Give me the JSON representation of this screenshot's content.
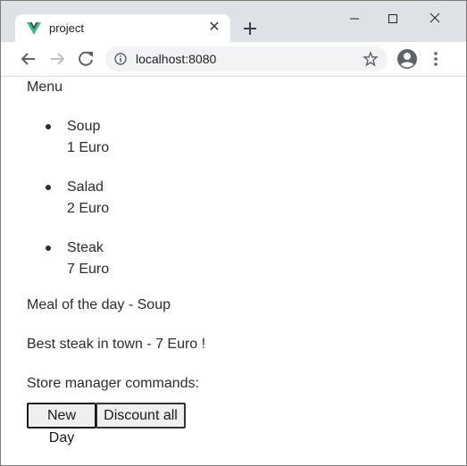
{
  "browser": {
    "tab": {
      "title": "project",
      "favicon": "vue-logo-icon",
      "close_glyph": "✕"
    },
    "new_tab_icon": "plus-icon",
    "window_controls": [
      "minimize-icon",
      "maximize-icon",
      "close-icon"
    ],
    "address": "localhost:8080",
    "colors": {
      "tabstrip": "#dee1e6",
      "omnibox": "#f1f3f4",
      "vue_green": "#41b883",
      "vue_dark": "#35495e"
    }
  },
  "page": {
    "menu_heading": "Menu",
    "menu_items": [
      {
        "name": "Soup",
        "price": "1 Euro"
      },
      {
        "name": "Salad",
        "price": "2 Euro"
      },
      {
        "name": "Steak",
        "price": "7 Euro"
      }
    ],
    "meal_of_day": "Meal of the day - Soup",
    "best_steak": "Best steak in town - 7 Euro !",
    "store_manager_label": "Store manager commands:",
    "buttons": {
      "new_day": "New Day",
      "discount_all": "Discount all"
    }
  }
}
